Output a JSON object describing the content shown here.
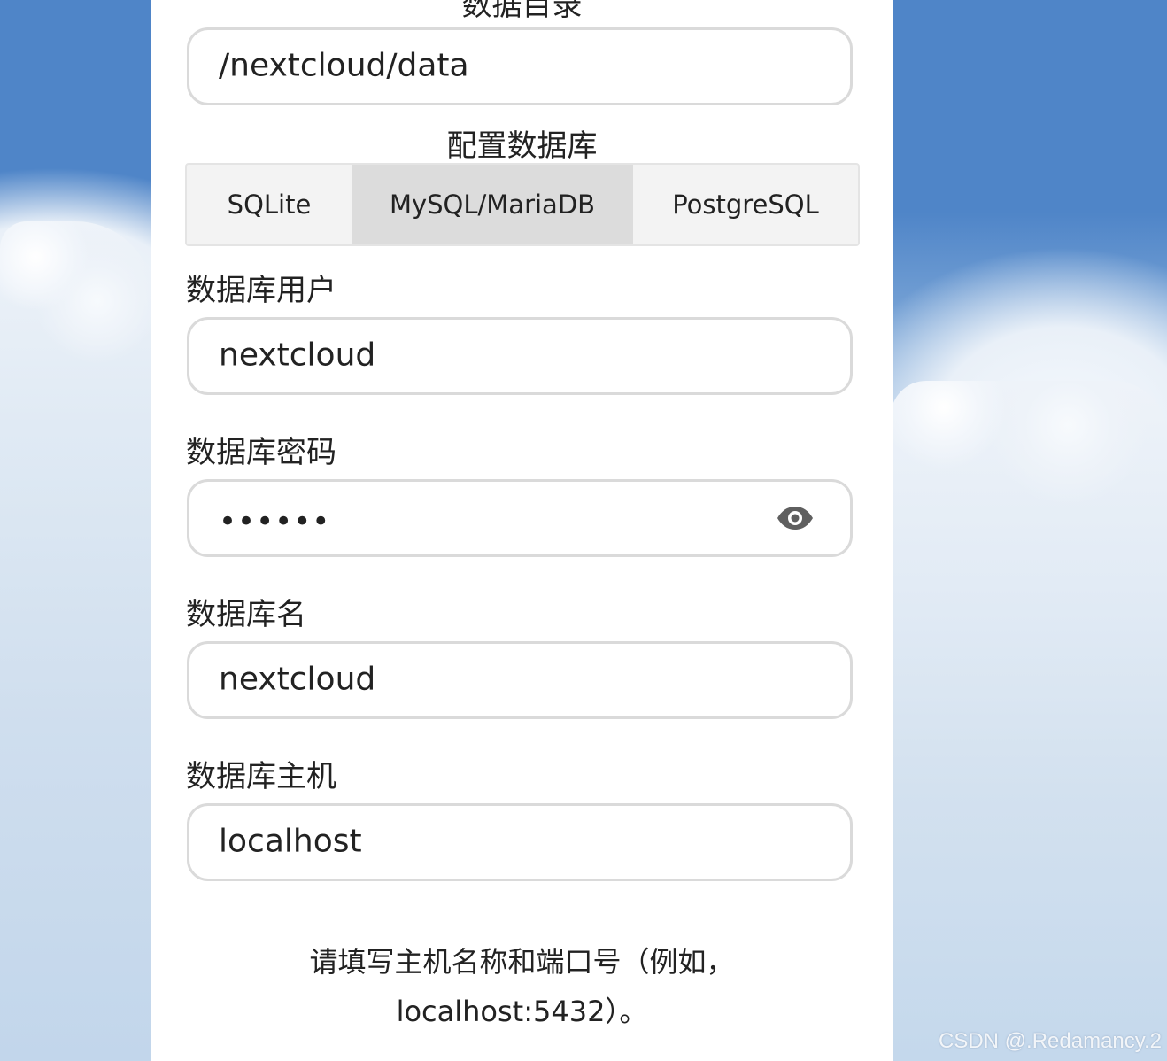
{
  "data_folder": {
    "heading": "数据目录",
    "value": "/nextcloud/data"
  },
  "database": {
    "heading": "配置数据库",
    "tabs": [
      {
        "label": "SQLite",
        "active": false
      },
      {
        "label": "MySQL/MariaDB",
        "active": true
      },
      {
        "label": "PostgreSQL",
        "active": false
      }
    ],
    "user_label": "数据库用户",
    "user_value": "nextcloud",
    "password_label": "数据库密码",
    "password_value": "••••••",
    "password_toggle_icon": "eye-icon",
    "name_label": "数据库名",
    "name_value": "nextcloud",
    "host_label": "数据库主机",
    "host_value": "localhost",
    "host_hint_line1": "请填写主机名称和端口号（例如，",
    "host_hint_line2": "localhost:5432）。"
  },
  "watermark": "CSDN @.Redamancy.2",
  "colors": {
    "sky": "#4f85c8",
    "panel": "#ffffff",
    "field_border": "#dadada",
    "active_tab": "#dcdcdc",
    "tab_bar": "#f3f3f3"
  }
}
